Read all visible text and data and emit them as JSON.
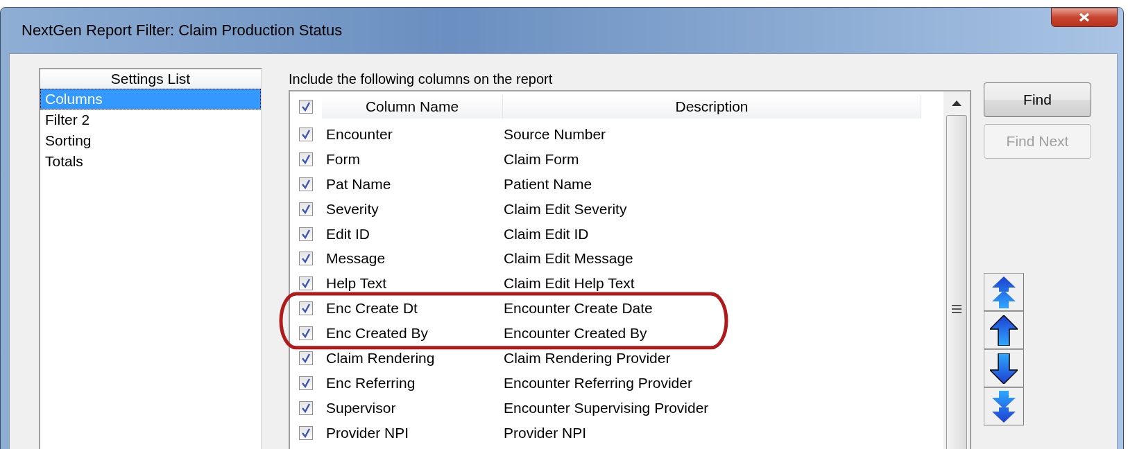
{
  "window": {
    "title": "NextGen Report Filter: Claim Production Status"
  },
  "settings_list": {
    "header": "Settings List",
    "items": [
      {
        "label": "Columns",
        "selected": true
      },
      {
        "label": "Filter 2",
        "selected": false
      },
      {
        "label": "Sorting",
        "selected": false
      },
      {
        "label": "Totals",
        "selected": false
      }
    ]
  },
  "columns_table": {
    "caption": "Include the following columns on the report",
    "all_checked": true,
    "columns": [
      "Column Name",
      "Description"
    ],
    "rows": [
      {
        "name": "Encounter",
        "description": "Source Number",
        "checked": true,
        "highlighted": false
      },
      {
        "name": "Form",
        "description": "Claim Form",
        "checked": true,
        "highlighted": false
      },
      {
        "name": "Pat Name",
        "description": "Patient Name",
        "checked": true,
        "highlighted": false
      },
      {
        "name": "Severity",
        "description": "Claim Edit Severity",
        "checked": true,
        "highlighted": false
      },
      {
        "name": "Edit ID",
        "description": "Claim Edit ID",
        "checked": true,
        "highlighted": false
      },
      {
        "name": "Message",
        "description": "Claim Edit Message",
        "checked": true,
        "highlighted": false
      },
      {
        "name": "Help Text",
        "description": "Claim Edit Help Text",
        "checked": true,
        "highlighted": false
      },
      {
        "name": "Enc Create Dt",
        "description": "Encounter Create Date",
        "checked": true,
        "highlighted": true
      },
      {
        "name": "Enc Created By",
        "description": "Encounter Created By",
        "checked": true,
        "highlighted": true
      },
      {
        "name": "Claim Rendering",
        "description": "Claim Rendering Provider",
        "checked": true,
        "highlighted": false
      },
      {
        "name": "Enc Referring",
        "description": "Encounter Referring Provider",
        "checked": true,
        "highlighted": false
      },
      {
        "name": "Supervisor",
        "description": "Encounter Supervising Provider",
        "checked": true,
        "highlighted": false
      },
      {
        "name": "Provider NPI",
        "description": "Provider NPI",
        "checked": true,
        "highlighted": false
      }
    ]
  },
  "buttons": [
    {
      "label": "Find",
      "disabled": false
    },
    {
      "label": "Find Next",
      "disabled": true
    }
  ],
  "move_buttons": [
    {
      "kind": "top"
    },
    {
      "kind": "up"
    },
    {
      "kind": "down"
    },
    {
      "kind": "bottom"
    }
  ]
}
